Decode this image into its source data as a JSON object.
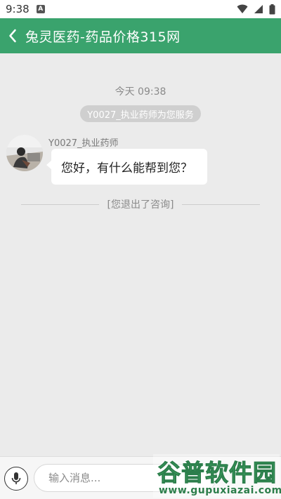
{
  "status_bar": {
    "time": "9:38",
    "notification_icon": "a-notification-icon",
    "wifi_icon": "wifi-icon",
    "signal_icon": "signal-icon",
    "battery_icon": "battery-icon"
  },
  "app_bar": {
    "title": "兔灵医药-药品价格315网",
    "back_icon": "chevron-left-icon",
    "color": "#3aa36d"
  },
  "chat": {
    "time_label": "今天 09:38",
    "service_notice": "Y0027_执业药师为您服务",
    "messages": [
      {
        "sender": "Y0027_执业药师",
        "text": "您好，有什么能帮到您？"
      }
    ],
    "system_notice": "[您退出了咨询]"
  },
  "input_bar": {
    "mic_icon": "microphone-icon",
    "placeholder": "输入消息..."
  },
  "watermark": {
    "logo_text": "谷普软件园",
    "url": "www.gupuxiazai.com"
  }
}
